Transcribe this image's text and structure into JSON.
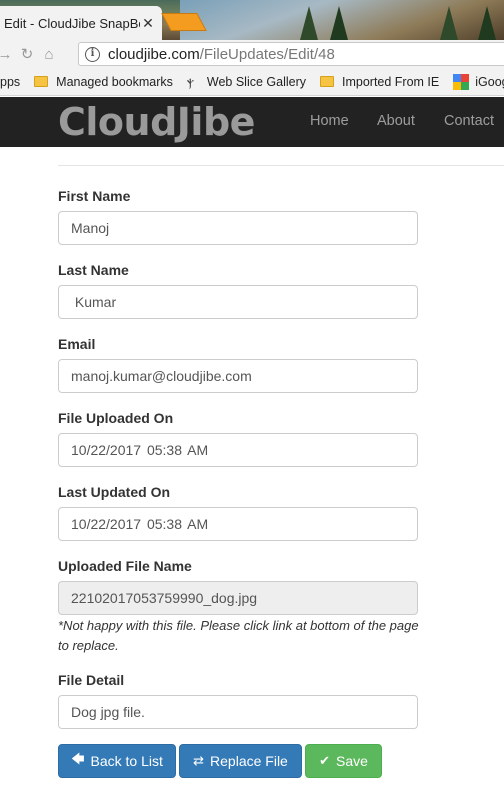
{
  "browser": {
    "tab_title": "Edit - CloudJibe SnapBox",
    "url_domain": "cloudjibe.com",
    "url_path": "/FileUpdates/Edit/48",
    "bookmarks": [
      {
        "label": "pps",
        "icon": "apps-icon"
      },
      {
        "label": "Managed bookmarks",
        "icon": "folder-icon"
      },
      {
        "label": "Web Slice Gallery",
        "icon": "web-slice-icon"
      },
      {
        "label": "Imported From IE",
        "icon": "folder-icon"
      },
      {
        "label": "iGoogle",
        "icon": "google-icon"
      }
    ]
  },
  "site": {
    "logo": "CloudJibe",
    "nav": [
      "Home",
      "About",
      "Contact"
    ]
  },
  "form": {
    "first_name_label": "First Name",
    "first_name_value": "Manoj",
    "last_name_label": "Last Name",
    "last_name_value": " Kumar",
    "email_label": "Email",
    "email_value": "manoj.kumar@cloudjibe.com",
    "uploaded_on_label": "File Uploaded On",
    "uploaded_on_value": "10/22/2017 05:38 AM",
    "updated_on_label": "Last Updated On",
    "updated_on_value": "10/22/2017 05:38 AM",
    "file_name_label": "Uploaded File Name",
    "file_name_value": "22102017053759990_dog.jpg",
    "note": "*Not happy with this file. Please click link at bottom of the page to replace.",
    "file_detail_label": "File Detail",
    "file_detail_value": "Dog jpg file."
  },
  "buttons": {
    "back": "Back to List",
    "replace": "Replace File",
    "save": "Save"
  },
  "colors": {
    "primary": "#337ab7",
    "success": "#5cb85c",
    "header_bg": "#222222"
  }
}
